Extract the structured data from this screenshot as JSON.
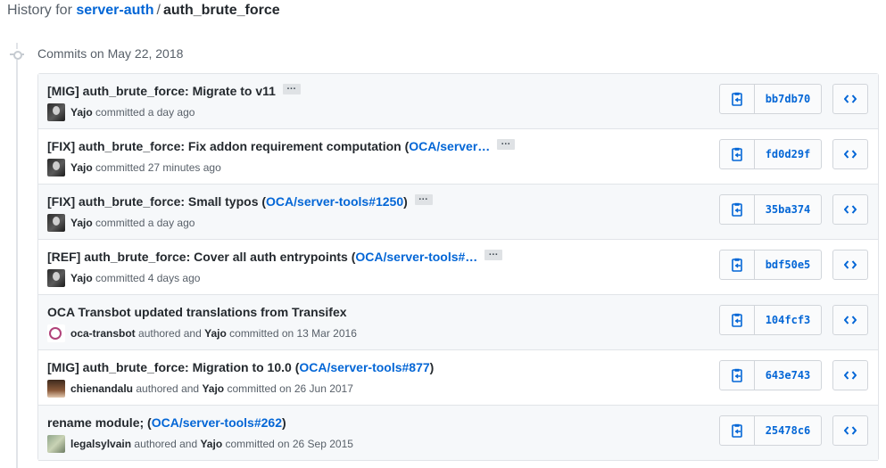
{
  "header": {
    "prefix": "History for",
    "repo": "server-auth",
    "separator": "/",
    "file": "auth_brute_force"
  },
  "timeline": {
    "date_label": "Commits on May 22, 2018"
  },
  "icons": {
    "copy": "clipboard-icon",
    "browse": "code-icon",
    "more": "ellipsis-icon"
  },
  "commits": [
    {
      "title": "[MIG] auth_brute_force: Migrate to v11",
      "ref": "",
      "title_after": "",
      "has_ellipsis": true,
      "author": "",
      "author_suffix": "",
      "committer": "Yajo",
      "committed_text": "committed a day ago",
      "avatar": "yajo",
      "sha": "bb7db70"
    },
    {
      "title": "[FIX] auth_brute_force: Fix addon requirement computation (",
      "ref": "OCA/server…",
      "title_after": "",
      "has_ellipsis": true,
      "author": "",
      "author_suffix": "",
      "committer": "Yajo",
      "committed_text": "committed 27 minutes ago",
      "avatar": "yajo",
      "sha": "fd0d29f"
    },
    {
      "title": "[FIX] auth_brute_force: Small typos (",
      "ref": "OCA/server-tools#1250",
      "title_after": ")",
      "has_ellipsis": true,
      "author": "",
      "author_suffix": "",
      "committer": "Yajo",
      "committed_text": "committed a day ago",
      "avatar": "yajo",
      "sha": "35ba374"
    },
    {
      "title": "[REF] auth_brute_force: Cover all auth entrypoints (",
      "ref": "OCA/server-tools#…",
      "title_after": "",
      "has_ellipsis": true,
      "author": "",
      "author_suffix": "",
      "committer": "Yajo",
      "committed_text": "committed 4 days ago",
      "avatar": "yajo",
      "sha": "bdf50e5"
    },
    {
      "title": "OCA Transbot updated translations from Transifex",
      "ref": "",
      "title_after": "",
      "has_ellipsis": false,
      "author": "oca-transbot",
      "author_suffix": "authored and",
      "committer": "Yajo",
      "committed_text": "committed on 13 Mar 2016",
      "avatar": "oca",
      "sha": "104fcf3"
    },
    {
      "title": "[MIG] auth_brute_force: Migration to 10.0 (",
      "ref": "OCA/server-tools#877",
      "title_after": ")",
      "has_ellipsis": false,
      "author": "chienandalu",
      "author_suffix": "authored and",
      "committer": "Yajo",
      "committed_text": "committed on 26 Jun 2017",
      "avatar": "chien",
      "sha": "643e743"
    },
    {
      "title": "rename module; (",
      "ref": "OCA/server-tools#262",
      "title_after": ")",
      "has_ellipsis": false,
      "author": "legalsylvain",
      "author_suffix": "authored and",
      "committer": "Yajo",
      "committed_text": "committed on 26 Sep 2015",
      "avatar": "legal",
      "sha": "25478c6"
    }
  ]
}
